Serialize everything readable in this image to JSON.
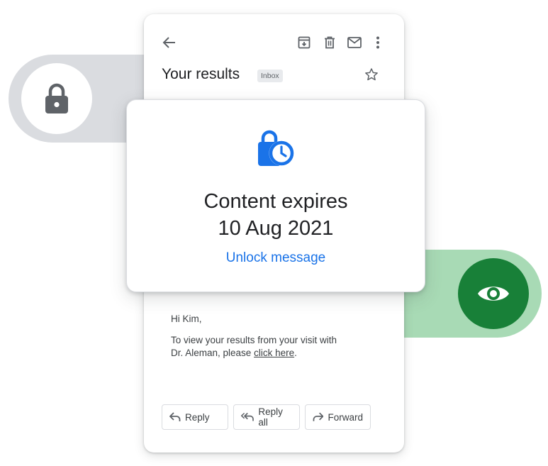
{
  "email": {
    "subject": "Your results",
    "label": "Inbox",
    "greeting": "Hi Kim,",
    "body_prefix": "To view your results from your visit with Dr. Aleman, please ",
    "body_link": "click here",
    "body_suffix": "."
  },
  "toolbar": {
    "icons": [
      "back-arrow-icon",
      "archive-icon",
      "delete-icon",
      "mark-unread-icon",
      "more-vert-icon",
      "star-icon"
    ]
  },
  "actions": {
    "reply": "Reply",
    "reply_all": "Reply all",
    "forward": "Forward"
  },
  "modal": {
    "title_line1": "Content expires",
    "title_line2": "10 Aug 2021",
    "unlock_label": "Unlock message"
  },
  "colors": {
    "accent_blue": "#1a73e8",
    "green_dark": "#188038",
    "green_light": "#a8dab5",
    "grey_pill": "#dadce0",
    "lock_icon": "#5f6368"
  }
}
